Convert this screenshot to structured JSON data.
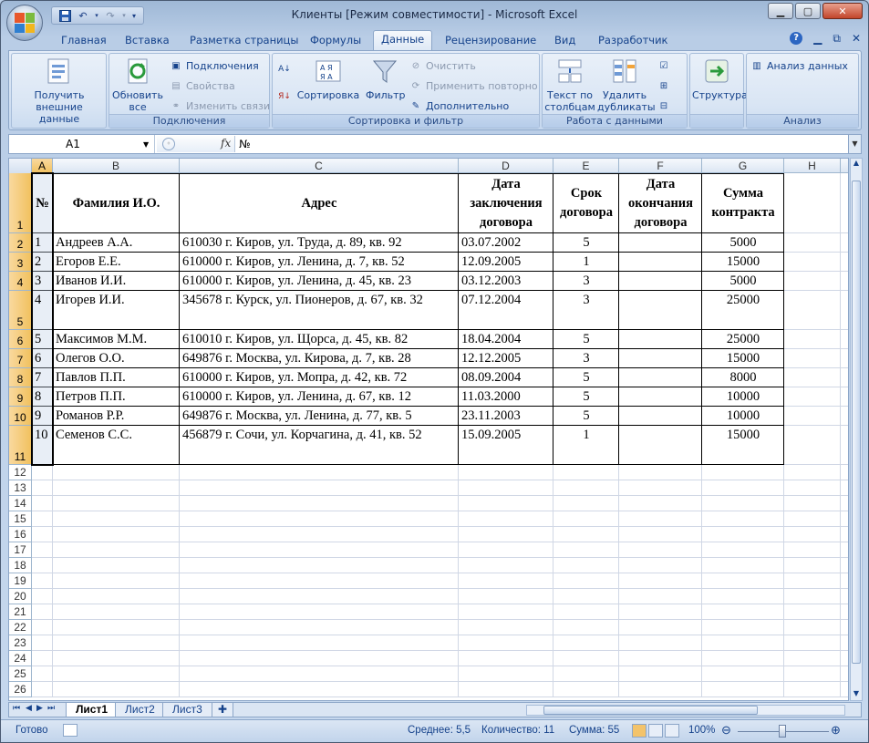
{
  "window": {
    "title": "Клиенты  [Режим совместимости] - Microsoft Excel",
    "minimize": "▁",
    "maximize": "▢",
    "close": "✕"
  },
  "qat": {
    "save_icon": "save-icon",
    "undo_icon": "undo-icon",
    "redo_icon": "redo-icon"
  },
  "tabs": [
    {
      "label": "Главная"
    },
    {
      "label": "Вставка"
    },
    {
      "label": "Разметка страницы"
    },
    {
      "label": "Формулы"
    },
    {
      "label": "Данные",
      "active": true
    },
    {
      "label": "Рецензирование"
    },
    {
      "label": "Вид"
    },
    {
      "label": "Разработчик"
    }
  ],
  "ribbon": {
    "get_external": "Получить внешние данные",
    "refresh_all": "Обновить все",
    "connections": "Подключения",
    "properties": "Свойства",
    "edit_links": "Изменить связи",
    "group_connections": "Подключения",
    "sort": "Сортировка",
    "filter": "Фильтр",
    "clear": "Очистить",
    "reapply": "Применить повторно",
    "advanced": "Дополнительно",
    "group_sort": "Сортировка и фильтр",
    "text_to_columns": "Текст по столбцам",
    "remove_duplicates": "Удалить дубликаты",
    "group_data_tools": "Работа с данными",
    "outline": "Структура",
    "data_analysis": "Анализ данных",
    "group_analysis": "Анализ"
  },
  "formula_bar": {
    "name_box": "A1",
    "fx": "fx",
    "formula": "№"
  },
  "columns": [
    "A",
    "B",
    "C",
    "D",
    "E",
    "F",
    "G",
    "H"
  ],
  "rows": [
    "1",
    "2",
    "3",
    "4",
    "5",
    "6",
    "7",
    "8",
    "9",
    "10",
    "11",
    "12",
    "13",
    "14",
    "15",
    "16",
    "17",
    "18",
    "19",
    "20",
    "21",
    "22",
    "23",
    "24",
    "25",
    "26"
  ],
  "table": {
    "headers": [
      "№",
      "Фамилия И.О.",
      "Адрес",
      "Дата заключения договора",
      "Срок договора",
      "Дата окончания договора",
      "Сумма контракта"
    ],
    "rows": [
      [
        "1",
        "Андреев А.А.",
        "610030 г. Киров, ул. Труда, д. 89, кв. 92",
        "03.07.2002",
        "5",
        "",
        "5000"
      ],
      [
        "2",
        "Егоров Е.Е.",
        "610000 г. Киров, ул. Ленина, д. 7, кв. 52",
        "12.09.2005",
        "1",
        "",
        "15000"
      ],
      [
        "3",
        "Иванов И.И.",
        "610000 г. Киров, ул. Ленина, д. 45, кв. 23",
        "03.12.2003",
        "3",
        "",
        "5000"
      ],
      [
        "4",
        "Игорев И.И.",
        "345678 г. Курск, ул. Пионеров, д. 67, кв. 32",
        "07.12.2004",
        "3",
        "",
        "25000"
      ],
      [
        "5",
        "Максимов М.М.",
        "610010 г. Киров, ул. Щорса, д. 45, кв. 82",
        "18.04.2004",
        "5",
        "",
        "25000"
      ],
      [
        "6",
        "Олегов О.О.",
        "649876 г. Москва, ул. Кирова, д. 7, кв. 28",
        "12.12.2005",
        "3",
        "",
        "15000"
      ],
      [
        "7",
        "Павлов П.П.",
        "610000 г. Киров, ул. Мопра, д. 42, кв. 72",
        "08.09.2004",
        "5",
        "",
        "8000"
      ],
      [
        "8",
        "Петров П.П.",
        "610000 г. Киров, ул. Ленина, д. 67, кв. 12",
        "11.03.2000",
        "5",
        "",
        "10000"
      ],
      [
        "9",
        "Романов Р.Р.",
        "649876 г. Москва, ул. Ленина, д. 77, кв. 5",
        "23.11.2003",
        "5",
        "",
        "10000"
      ],
      [
        "10",
        "Семенов С.С.",
        "456879 г. Сочи, ул. Корчагина, д. 41, кв. 52",
        "15.09.2005",
        "1",
        "",
        "15000"
      ]
    ]
  },
  "sheets": [
    {
      "label": "Лист1",
      "active": true
    },
    {
      "label": "Лист2"
    },
    {
      "label": "Лист3"
    }
  ],
  "status": {
    "ready": "Готово",
    "average": "Среднее: 5,5",
    "count": "Количество: 11",
    "sum": "Сумма: 55",
    "zoom": "100%"
  }
}
